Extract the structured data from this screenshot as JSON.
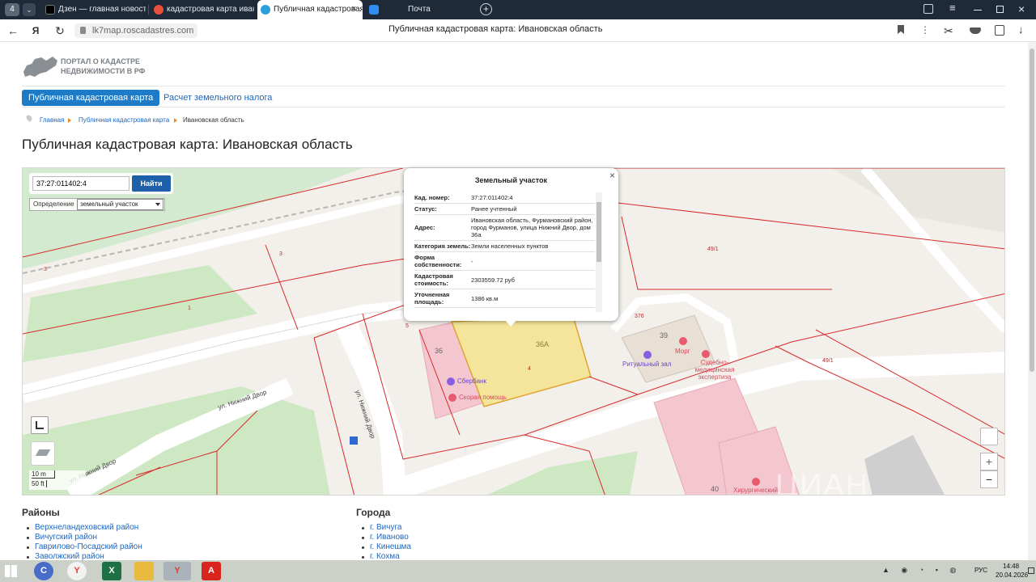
{
  "browser": {
    "tabs": [
      {
        "label": "Дзен — главная новостная",
        "active": false
      },
      {
        "label": "кадастровая карта ивановс",
        "active": false
      },
      {
        "label": "Публичная кадастровая",
        "active": true
      },
      {
        "label": "Почта",
        "active": false
      }
    ],
    "url": "lk7map.roscadastres.com",
    "page_title": "Публичная кадастровая карта: Ивановская область",
    "tab_count": "4"
  },
  "site": {
    "logo_line1": "ПОРТАЛ О КАДАСТРЕ",
    "logo_line2": "НЕДВИЖИМОСТИ В РФ",
    "menu": [
      "Публичная кадастровая карта",
      "Расчет земельного налога"
    ],
    "breadcrumb": [
      "Главная",
      "Публичная кадастровая карта",
      "Ивановская область"
    ],
    "heading": "Публичная кадастровая карта: Ивановская область"
  },
  "map_controls": {
    "search_value": "37:27:011402:4",
    "search_button": "Найти",
    "mode_label": "Определение",
    "mode_value": "земельный участок",
    "scale_m": "10 m",
    "scale_ft": "50 ft",
    "zoom_in": "+",
    "zoom_out": "−"
  },
  "map_labels": {
    "parcel_3a": "3",
    "parcel_3b": "3",
    "parcel_1": "1",
    "parcel_5": "5",
    "parcel_4": "4",
    "parcel_49_1a": "49/1",
    "parcel_49_1b": "49/1",
    "parcel_376": "376",
    "bldg_36": "36",
    "bldg_36a": "36А",
    "bldg_39": "39",
    "bldg_40": "40",
    "street_1": "ул. Нижний Двор",
    "street_2": "ул. Нижний Двор",
    "street_3": "ул. Нижний Двор",
    "poi_sber": "Сбербанк",
    "poi_ambulance": "Скорая помощь",
    "poi_ritual": "Ритуальный зал",
    "poi_morg": "Морг",
    "poi_expert": "Судебно-медицинская экспертиза",
    "poi_surg": "Хирургический",
    "watermark": "ЦИАН"
  },
  "popup": {
    "title": "Земельный участок",
    "close": "×",
    "rows": [
      {
        "k": "Кад. номер:",
        "v": "37:27:011402:4"
      },
      {
        "k": "Статус:",
        "v": "Ранее учтенный"
      },
      {
        "k": "Адрес:",
        "v": "Ивановская область, Фурмановский район, город Фурманов, улица Нижний Двор, дом 36а"
      },
      {
        "k": "Категория земель:",
        "v": "Земли населенных пунктов"
      },
      {
        "k": "Форма собственности:",
        "v": "-"
      },
      {
        "k": "Кадастровая стоимость:",
        "v": "2303559.72 руб"
      },
      {
        "k": "Уточненная площадь:",
        "v": "1386 кв.м"
      }
    ]
  },
  "regions": {
    "title": "Районы",
    "items": [
      "Верхнеландеховский район",
      "Вичугский район",
      "Гаврилово-Посадский район",
      "Заволжский район"
    ]
  },
  "cities": {
    "title": "Города",
    "items": [
      "г. Вичуга",
      "г. Иваново",
      "г. Кинешма",
      "г. Кохма"
    ]
  },
  "tray": {
    "lang": "РУС",
    "time": "14:48",
    "date": "20.04.2026"
  },
  "colors": {
    "accent": "#1d7bc7",
    "parcel_line": "#d62a2a",
    "selected_parcel": "#f5e59a",
    "building_pink": "#f4c7d0",
    "green": "#cfe8c4"
  }
}
